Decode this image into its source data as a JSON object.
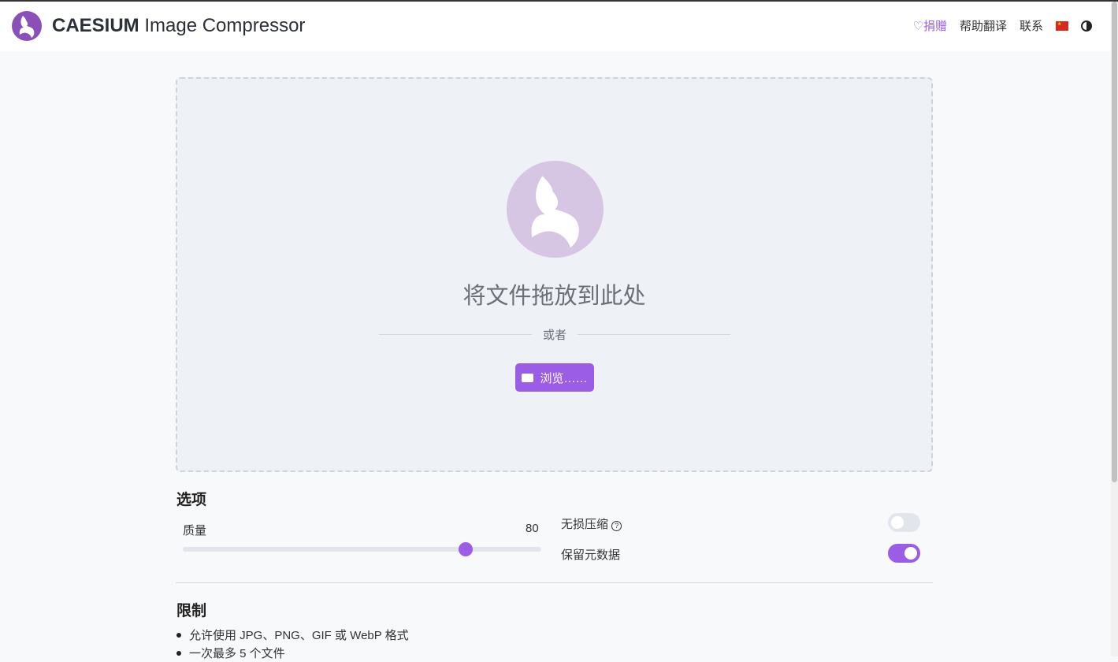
{
  "header": {
    "brand_bold": "CAESIUM",
    "brand_rest": " Image Compressor",
    "nav": {
      "donate": "♡捐赠",
      "translate": "帮助翻译",
      "contact": "联系"
    }
  },
  "dropzone": {
    "text": "将文件拖放到此处",
    "or": "或者",
    "browse": "浏览……"
  },
  "options": {
    "title": "选项",
    "quality_label": "质量",
    "quality_value": "80",
    "quality_fraction": 0.79,
    "lossless_label": "无损压缩",
    "lossless_on": false,
    "metadata_label": "保留元数据",
    "metadata_on": true
  },
  "limits": {
    "title": "限制",
    "items": [
      "允许使用 JPG、PNG、GIF 或 WebP 格式",
      "一次最多 5 个文件"
    ]
  },
  "colors": {
    "accent": "#9b5de5"
  }
}
